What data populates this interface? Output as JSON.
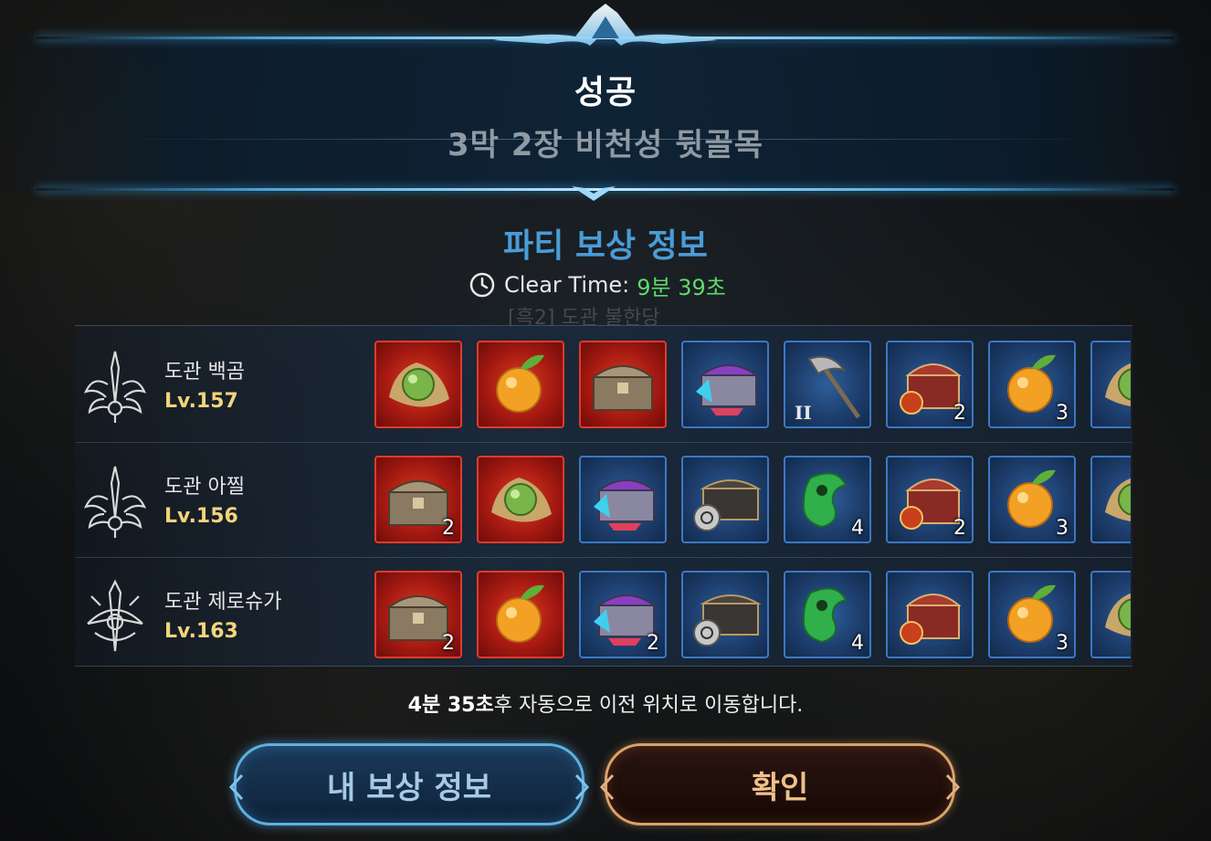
{
  "header": {
    "title": "성공",
    "subtitle": "3막 2장 비천성 뒷골목"
  },
  "section": {
    "title": "파티 보상 정보",
    "clear_label": "Clear Time:",
    "clear_value": "9분 39초",
    "ghost_text": "[흑2] 도관 불한당"
  },
  "party": [
    {
      "name": "도관 백곰",
      "level": "Lv.157",
      "class_icon": "winged-blade-crest-icon",
      "items": [
        {
          "icon": "green-orb-wrapped-icon",
          "rarity": "red",
          "qty": ""
        },
        {
          "icon": "orange-fruit-icon",
          "rarity": "red",
          "qty": ""
        },
        {
          "icon": "treasure-chest-icon",
          "rarity": "red",
          "qty": ""
        },
        {
          "icon": "purple-crystal-chest-icon",
          "rarity": "blue",
          "qty": ""
        },
        {
          "icon": "pickaxe-icon",
          "rarity": "blue",
          "qty": "",
          "tier": "II"
        },
        {
          "icon": "red-ornate-chest-icon",
          "rarity": "blue",
          "qty": "2"
        },
        {
          "icon": "orange-fruit-icon",
          "rarity": "blue",
          "qty": "3"
        },
        {
          "icon": "green-orb-wrapped-icon",
          "rarity": "blue",
          "qty": ""
        }
      ]
    },
    {
      "name": "도관 아찔",
      "level": "Lv.156",
      "class_icon": "winged-blade-crest-icon",
      "items": [
        {
          "icon": "treasure-chest-icon",
          "rarity": "red",
          "qty": "2"
        },
        {
          "icon": "green-orb-wrapped-icon",
          "rarity": "red",
          "qty": ""
        },
        {
          "icon": "purple-crystal-chest-icon",
          "rarity": "blue",
          "qty": ""
        },
        {
          "icon": "dark-coin-chest-icon",
          "rarity": "blue",
          "qty": ""
        },
        {
          "icon": "green-jade-icon",
          "rarity": "blue",
          "qty": "4"
        },
        {
          "icon": "red-ornate-chest-icon",
          "rarity": "blue",
          "qty": "2"
        },
        {
          "icon": "orange-fruit-icon",
          "rarity": "blue",
          "qty": "3"
        },
        {
          "icon": "green-orb-wrapped-icon",
          "rarity": "blue",
          "qty": ""
        }
      ]
    },
    {
      "name": "도관 제로슈가",
      "level": "Lv.163",
      "class_icon": "crossbow-crest-icon",
      "items": [
        {
          "icon": "treasure-chest-icon",
          "rarity": "red",
          "qty": "2"
        },
        {
          "icon": "orange-fruit-icon",
          "rarity": "red",
          "qty": ""
        },
        {
          "icon": "purple-crystal-chest-icon",
          "rarity": "blue",
          "qty": "2"
        },
        {
          "icon": "dark-coin-chest-icon",
          "rarity": "blue",
          "qty": ""
        },
        {
          "icon": "green-jade-icon",
          "rarity": "blue",
          "qty": "4"
        },
        {
          "icon": "red-ornate-chest-icon",
          "rarity": "blue",
          "qty": ""
        },
        {
          "icon": "orange-fruit-icon",
          "rarity": "blue",
          "qty": "3"
        },
        {
          "icon": "green-orb-wrapped-icon",
          "rarity": "blue",
          "qty": ""
        }
      ]
    }
  ],
  "auto_message": {
    "time": "4분 35초",
    "text": "후 자동으로 이전 위치로 이동합니다."
  },
  "buttons": {
    "my_reward": "내 보상 정보",
    "confirm": "확인"
  },
  "colors": {
    "accent_blue": "#4a9cd6",
    "clear_green": "#5fd86a",
    "level_gold": "#f2d47a",
    "confirm_text": "#f0c08a"
  }
}
